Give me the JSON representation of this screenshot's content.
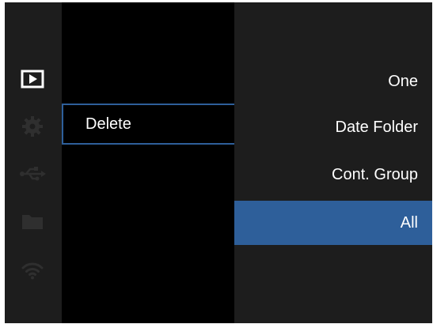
{
  "menu": {
    "sidebar_icons": [
      {
        "name": "playback-icon",
        "active": true
      },
      {
        "name": "gear-icon",
        "active": false
      },
      {
        "name": "usb-icon",
        "active": false
      },
      {
        "name": "folder-icon",
        "active": false
      },
      {
        "name": "wifi-icon",
        "active": false
      }
    ],
    "current_item_label": "Delete",
    "options": [
      {
        "label": "One",
        "selected": false
      },
      {
        "label": "Date Folder",
        "selected": false
      },
      {
        "label": "Cont. Group",
        "selected": false
      },
      {
        "label": "All",
        "selected": true
      }
    ]
  },
  "colors": {
    "accent": "#2e5f9a",
    "panel": "#1d1d1d",
    "background": "#000000",
    "inactive_icon": "#2f2f2f",
    "text": "#ffffff"
  }
}
